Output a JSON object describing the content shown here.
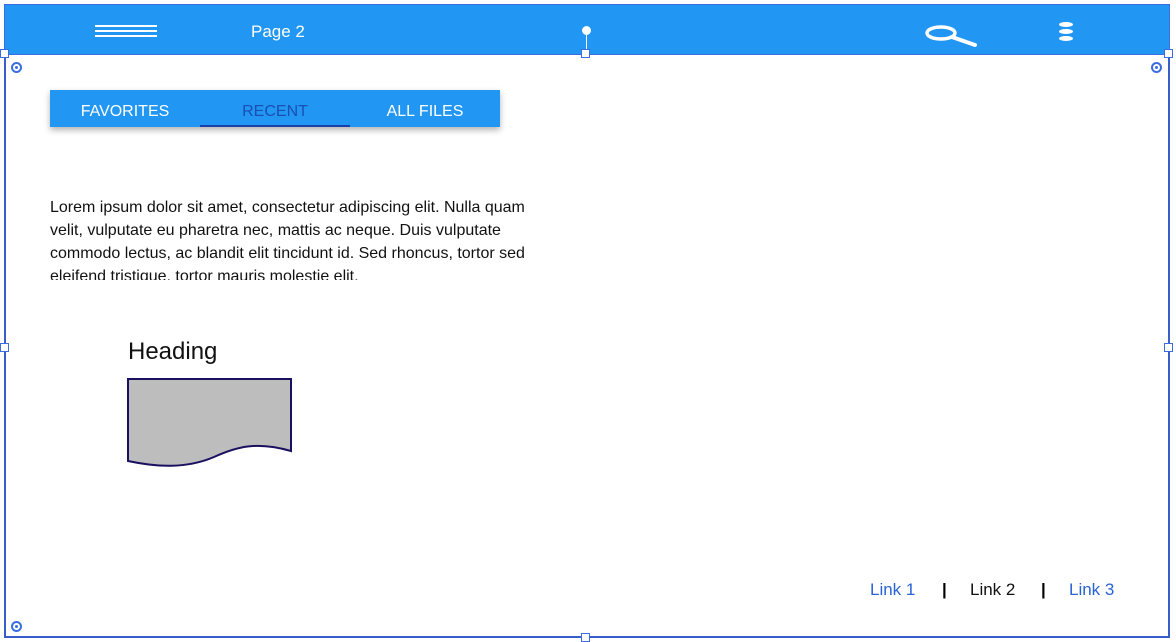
{
  "header": {
    "title": "Page 2",
    "menu_icon": "hamburger-icon",
    "search_icon": "search-icon",
    "more_icon": "more-vertical-icon"
  },
  "tabs": [
    {
      "label": "FAVORITES",
      "active": false
    },
    {
      "label": "RECENT",
      "active": true
    },
    {
      "label": "ALL FILES",
      "active": false
    }
  ],
  "content": {
    "paragraph": "Lorem ipsum dolor sit amet, consectetur adipiscing elit. Nulla quam velit, vulputate eu pharetra nec, mattis ac neque. Duis vulputate commodo lectus, ac blandit elit tincidunt id. Sed rhoncus, tortor sed eleifend tristique, tortor mauris molestie elit,",
    "heading": "Heading",
    "shape_icon": "document-shape"
  },
  "footer": {
    "links": [
      {
        "label": "Link 1",
        "active": false
      },
      {
        "label": "Link 2",
        "active": true
      },
      {
        "label": "Link 3",
        "active": false
      }
    ],
    "separator": "|"
  },
  "colors": {
    "primary": "#2196f3",
    "link": "#2a63d6",
    "selection": "#3a6ee0",
    "shape_fill": "#bdbdbd",
    "shape_stroke": "#1a1060"
  }
}
